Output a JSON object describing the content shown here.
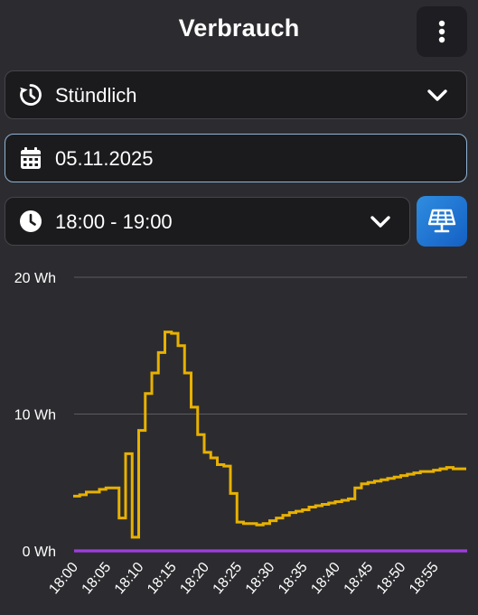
{
  "header": {
    "title": "Verbrauch"
  },
  "icons": {
    "menu": "more-vertical-icon",
    "interval": "history-icon",
    "date": "calendar-icon",
    "time": "clock-icon",
    "dropdown": "chevron-down-icon",
    "solar": "solar-panel-icon"
  },
  "interval_select": {
    "value": "Stündlich"
  },
  "date_field": {
    "value": "05.11.2025"
  },
  "time_select": {
    "value": "18:00 - 19:00"
  },
  "colors": {
    "consumption": "#e8b100",
    "baseline": "#a13de0",
    "accent_button": "#1f7ad6"
  },
  "chart_data": {
    "type": "line",
    "title": "",
    "xlabel": "",
    "ylabel": "",
    "ylim": [
      0,
      20
    ],
    "y_ticks": [
      "0 Wh",
      "10 Wh",
      "20 Wh"
    ],
    "y_tick_values": [
      0,
      10,
      20
    ],
    "x_ticks": [
      "18:00",
      "18:05",
      "18:10",
      "18:15",
      "18:20",
      "18:25",
      "18:30",
      "18:35",
      "18:40",
      "18:45",
      "18:50",
      "18:55"
    ],
    "step": true,
    "series": [
      {
        "color": "#e8b100",
        "x": [
          "18:00",
          "18:01",
          "18:02",
          "18:03",
          "18:04",
          "18:05",
          "18:06",
          "18:07",
          "18:08",
          "18:09",
          "18:10",
          "18:11",
          "18:12",
          "18:13",
          "18:14",
          "18:15",
          "18:16",
          "18:17",
          "18:18",
          "18:19",
          "18:20",
          "18:21",
          "18:22",
          "18:23",
          "18:24",
          "18:25",
          "18:26",
          "18:27",
          "18:28",
          "18:29",
          "18:30",
          "18:31",
          "18:32",
          "18:33",
          "18:34",
          "18:35",
          "18:36",
          "18:37",
          "18:38",
          "18:39",
          "18:40",
          "18:41",
          "18:42",
          "18:43",
          "18:44",
          "18:45",
          "18:46",
          "18:47",
          "18:48",
          "18:49",
          "18:50",
          "18:51",
          "18:52",
          "18:53",
          "18:54",
          "18:55",
          "18:56",
          "18:57",
          "18:58",
          "18:59"
        ],
        "values": [
          4.0,
          4.1,
          4.3,
          4.3,
          4.5,
          4.6,
          4.6,
          2.4,
          7.1,
          1.0,
          8.8,
          11.5,
          13.0,
          14.5,
          16.0,
          15.9,
          15.0,
          13.0,
          10.5,
          8.5,
          7.2,
          6.8,
          6.3,
          6.2,
          4.2,
          2.1,
          2.0,
          2.0,
          1.9,
          2.0,
          2.2,
          2.4,
          2.6,
          2.8,
          2.9,
          3.0,
          3.2,
          3.3,
          3.4,
          3.5,
          3.6,
          3.7,
          3.8,
          4.6,
          4.9,
          5.0,
          5.1,
          5.2,
          5.3,
          5.4,
          5.5,
          5.6,
          5.7,
          5.8,
          5.8,
          5.9,
          6.0,
          6.1,
          6.0,
          6.0
        ]
      },
      {
        "color": "#a13de0",
        "x": [
          "18:00",
          "18:59"
        ],
        "values": [
          0,
          0
        ]
      }
    ]
  }
}
